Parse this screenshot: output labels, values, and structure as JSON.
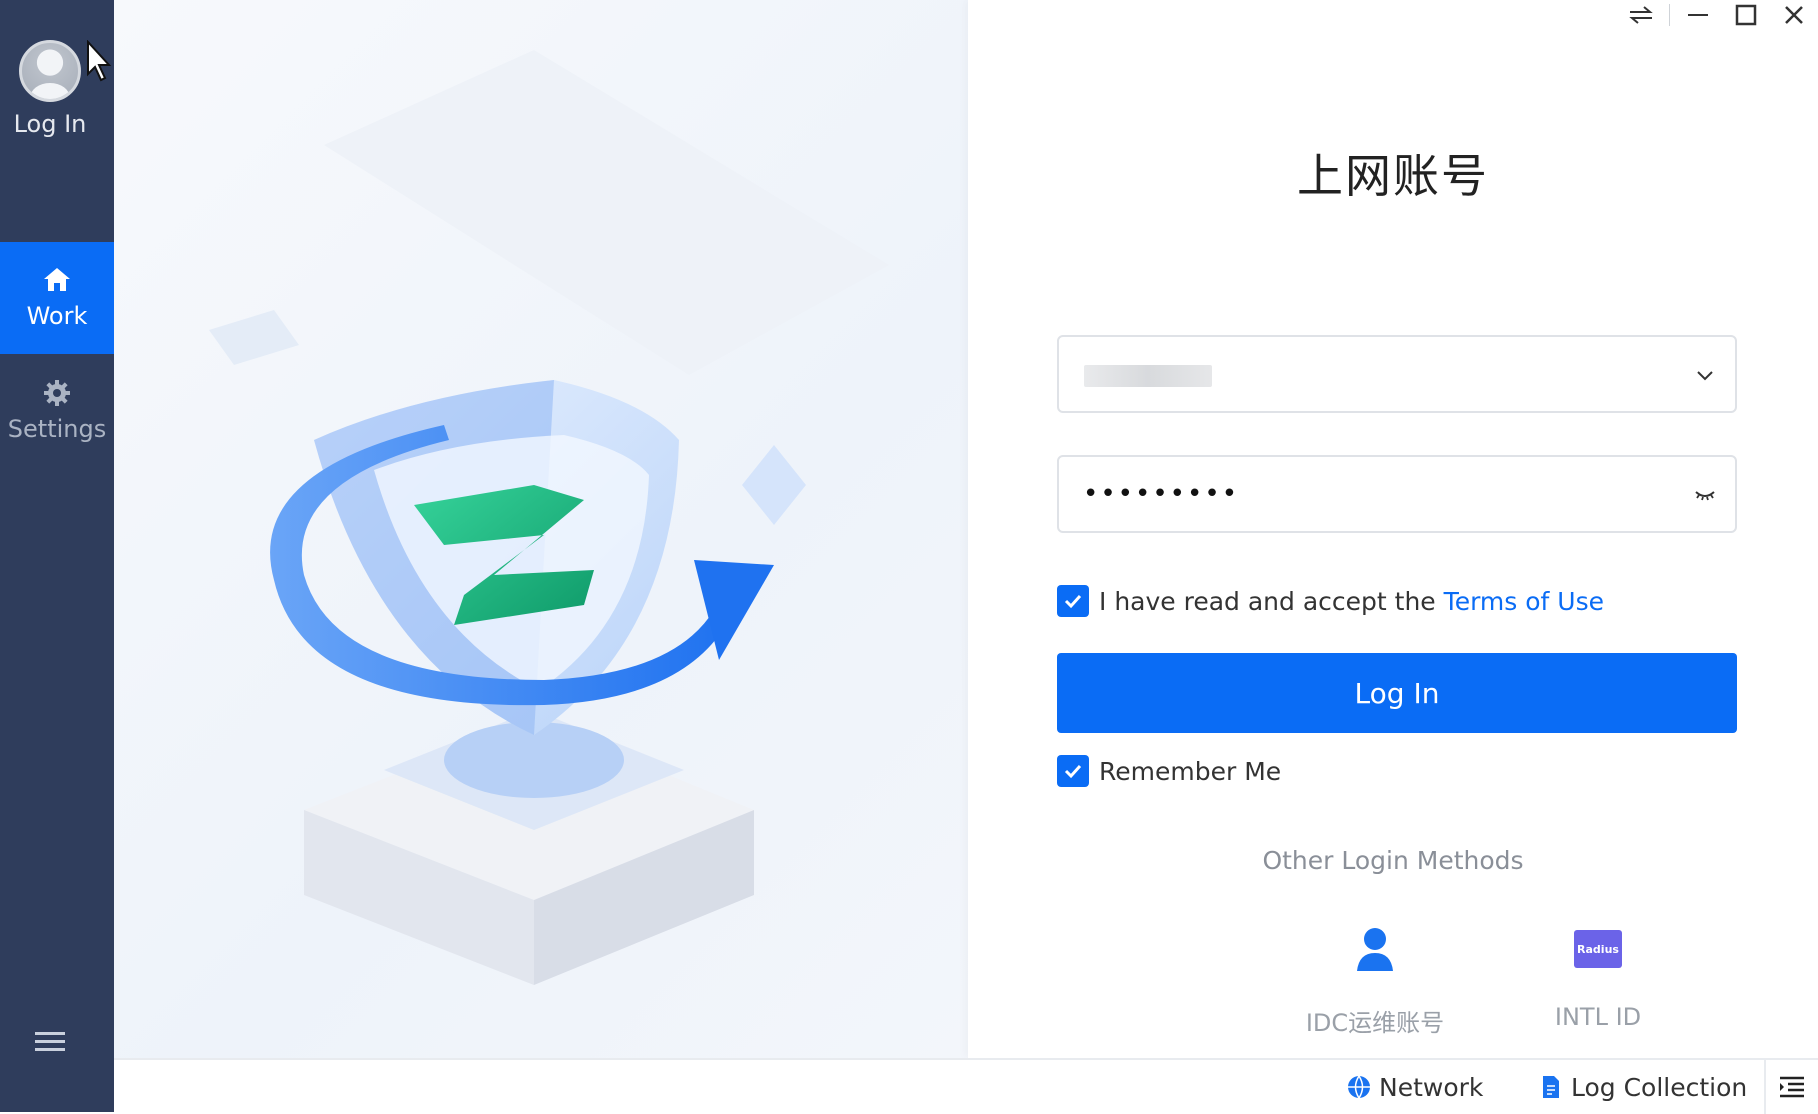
{
  "sidebar": {
    "profile_label": "Log In",
    "items": [
      {
        "label": "Work",
        "icon": "home-icon",
        "active": true
      },
      {
        "label": "Settings",
        "icon": "gear-icon",
        "active": false
      }
    ],
    "menu_icon": "hamburger-icon"
  },
  "window_controls": {
    "icons": [
      "swap-icon",
      "minimize-icon",
      "maximize-icon",
      "close-icon"
    ]
  },
  "login": {
    "title": "上网账号",
    "account_value": "",
    "password_dots": "•••••••••",
    "terms_prefix": "I have read and accept the",
    "terms_link": "Terms of Use",
    "terms_checked": true,
    "login_button": "Log In",
    "remember_me": "Remember Me",
    "remember_checked": true,
    "other_methods_title": "Other Login Methods",
    "methods": [
      {
        "label": "IDC运维账号",
        "icon": "user-icon"
      },
      {
        "label": "INTL ID",
        "icon": "radius-icon",
        "badge_text": "Radius"
      }
    ]
  },
  "footer": {
    "network": "Network",
    "log_collection": "Log Collection",
    "list_icon": "list-indent-icon"
  },
  "colors": {
    "sidebar": "#2f3d5c",
    "accent": "#0a6cf5",
    "radius_badge": "#6b63e8"
  }
}
